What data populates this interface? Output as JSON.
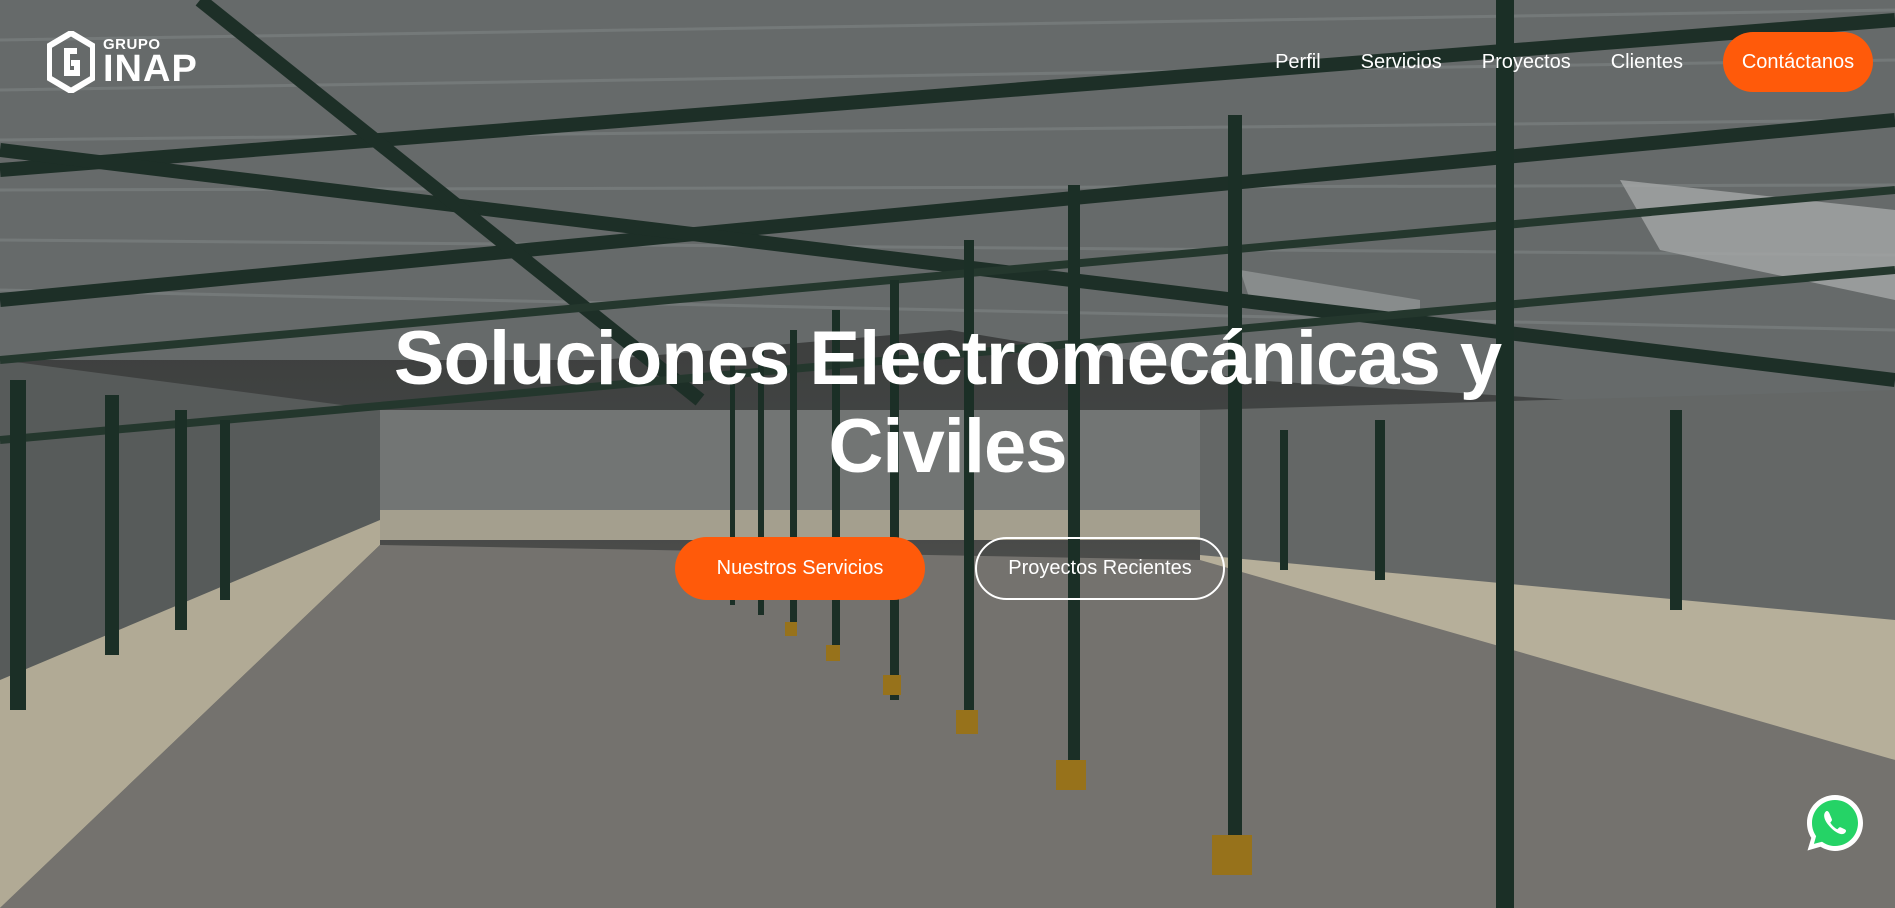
{
  "brand": {
    "small": "GRUPO",
    "name": "INAP",
    "logo_icon": "hexagon-g-logo-icon"
  },
  "nav": {
    "items": [
      {
        "label": "Perfil"
      },
      {
        "label": "Servicios"
      },
      {
        "label": "Proyectos"
      },
      {
        "label": "Clientes"
      }
    ],
    "cta": "Contáctanos"
  },
  "hero": {
    "title_line1": "Soluciones Electromecánicas y",
    "title_line2": "Civiles",
    "primary_button": "Nuestros Servicios",
    "secondary_button": "Proyectos Recientes",
    "background": "warehouse-steel-structure-photo"
  },
  "floating": {
    "icon": "whatsapp-icon"
  },
  "colors": {
    "accent": "#ff5a0a",
    "text": "#ffffff"
  }
}
